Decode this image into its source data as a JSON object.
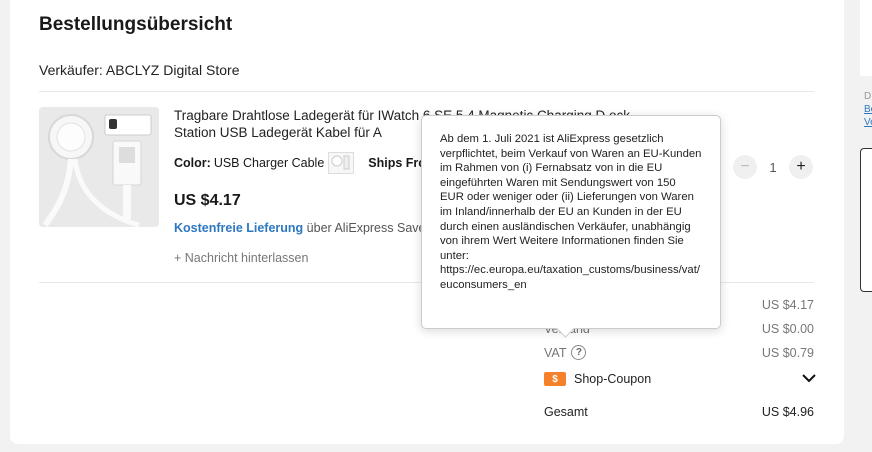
{
  "order": {
    "title": "Bestellungsübersicht",
    "seller": "Verkäufer: ABCLYZ Digital Store"
  },
  "product": {
    "title": "Tragbare Drahtlose Ladegerät für IWatch 6 SE 5 4 Magnetic Charging D ock Station USB Ladegerät Kabel für A",
    "color_label": "Color:",
    "color_value": "USB Charger Cable",
    "ships_label": "Ships From",
    "price": "US $4.17",
    "shipping_link": "Kostenfreie Lieferung",
    "shipping_rest": " über AliExpress Save",
    "note": "Nachricht hinterlassen",
    "thumb_tag": "Charger for Apple Watch",
    "quantity": "1"
  },
  "summary": {
    "rows": [
      {
        "label": "",
        "value": "US $4.17"
      },
      {
        "label": "Versand",
        "value": "US $0.00"
      },
      {
        "label": "VAT",
        "value": "US $0.79"
      }
    ],
    "coupon_label": "Shop-Coupon",
    "total_label": "Gesamt",
    "total_value": "US $4.96"
  },
  "tooltip": {
    "text": "Ab dem 1. Juli 2021 ist AliExpress gesetzlich verpflichtet, beim Verkauf von Waren an EU-Kunden im Rahmen von (i) Fernabsatz von in die EU eingeführten Waren mit Sendungswert von 150 EUR oder weniger oder (ii) Lieferungen von Waren im Inland/innerhalb der EU an Kunden in der EU durch einen ausländischen Verkäufer, unabhängig von ihrem Wert Weitere Informationen finden Sie unter: https://ec.europa.eu/taxation_customs/business/vat/euconsumers_en"
  },
  "side": {
    "line1": "D",
    "line2": "Be",
    "line3": "Ve"
  },
  "colors": {
    "link": "#2e78c1",
    "coupon": "#f5822a"
  }
}
